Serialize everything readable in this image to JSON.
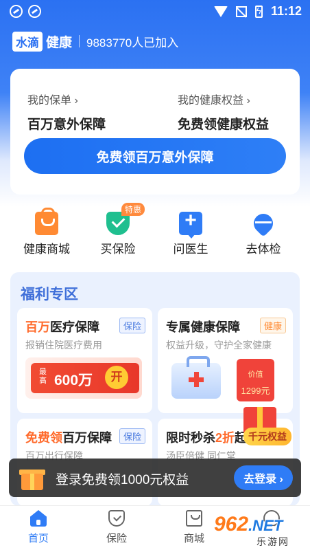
{
  "status_bar": {
    "time": "11:12"
  },
  "brand": {
    "logo_box": "水滴",
    "logo_text": "健康",
    "member_count": "9883770人已加入"
  },
  "top_card": {
    "policy_link": "我的保单 ›",
    "policy_value": "百万意外保障",
    "rights_link": "我的健康权益 ›",
    "rights_value": "免费领健康权益",
    "cta": "免费领百万意外保障"
  },
  "quick_actions": [
    {
      "label": "健康商城",
      "icon": "shopping-bag-icon"
    },
    {
      "label": "买保险",
      "icon": "shield-check-icon",
      "badge": "特惠"
    },
    {
      "label": "问医生",
      "icon": "doctor-chat-icon"
    },
    {
      "label": "去体检",
      "icon": "heart-pulse-icon"
    }
  ],
  "welfare": {
    "title": "福利专区",
    "cards": [
      {
        "title_accent": "百万",
        "title_rest": "医疗保障",
        "tag": "保险",
        "desc": "报销住院医疗费用",
        "small": "最高",
        "amount": "600万",
        "coin": "开"
      },
      {
        "title": "专属健康保障",
        "tag": "健康",
        "desc": "权益升级，守护全家健康",
        "env_top": "价值",
        "env_amount": "1299元"
      },
      {
        "title_accent": "免费领",
        "title_rest": "百万保障",
        "tag": "保险",
        "desc": "百万出行保障"
      },
      {
        "title_prefix": "限时秒杀",
        "title_accent": "2折",
        "title_rest": "起",
        "desc": "汤臣倍健 同仁堂"
      }
    ],
    "gift_badge": "千元权益"
  },
  "toast": {
    "text": "登录免费领1000元权益",
    "button": "去登录 ›"
  },
  "tab_bar": [
    {
      "label": "首页",
      "icon": "home-icon",
      "active": true
    },
    {
      "label": "保险",
      "icon": "shield-icon",
      "active": false
    },
    {
      "label": "商城",
      "icon": "bag-icon",
      "active": false
    },
    {
      "label": "",
      "icon": "profile-icon",
      "active": false
    }
  ],
  "watermark": {
    "main": "962",
    "net": ".NET",
    "sub": "乐游网"
  },
  "colors": {
    "primary": "#2f7cf6",
    "accent": "#ff6b2c",
    "tag_orange": "#ff8a33"
  }
}
